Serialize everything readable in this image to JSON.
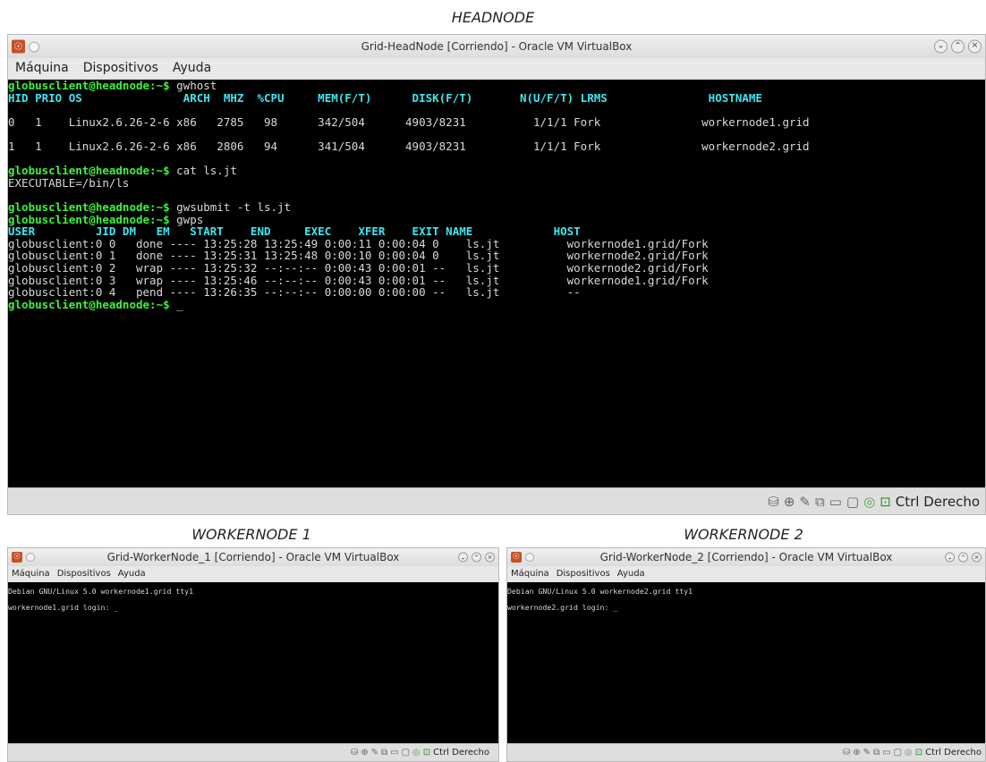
{
  "captions": {
    "headnode": "HEADNODE",
    "worker1": "WORKERNODE 1",
    "worker2": "WORKERNODE 2"
  },
  "headnode": {
    "title": "Grid-HeadNode [Corriendo] - Oracle VM VirtualBox",
    "menu": [
      "Máquina",
      "Dispositivos",
      "Ayuda"
    ],
    "host_key": "Ctrl Derecho",
    "terminal": {
      "prompt": "globusclient@headnode:~$",
      "cmd1": " gwhost",
      "gwhost_header": "HID PRIO OS               ARCH  MHZ  %CPU     MEM(F/T)      DISK(F/T)       N(U/F/T) LRMS               HOSTNAME",
      "gwhost_rows": [
        "0   1    Linux2.6.26-2-6 x86   2785   98      342/504      4903/8231          1/1/1 Fork               workernode1.grid",
        "1   1    Linux2.6.26-2-6 x86   2806   94      341/504      4903/8231          1/1/1 Fork               workernode2.grid"
      ],
      "cmd2": " cat ls.jt",
      "cat_output": "EXECUTABLE=/bin/ls",
      "cmd3": " gwsubmit -t ls.jt",
      "cmd4": " gwps",
      "gwps_header": "USER         JID DM   EM   START    END     EXEC    XFER    EXIT NAME            HOST",
      "gwps_rows": [
        "globusclient:0 0   done ---- 13:25:28 13:25:49 0:00:11 0:00:04 0    ls.jt          workernode1.grid/Fork",
        "globusclient:0 1   done ---- 13:25:31 13:25:48 0:00:10 0:00:04 0    ls.jt          workernode2.grid/Fork",
        "globusclient:0 2   wrap ---- 13:25:32 --:--:-- 0:00:43 0:00:01 --   ls.jt          workernode2.grid/Fork",
        "globusclient:0 3   wrap ---- 13:25:46 --:--:-- 0:00:43 0:00:01 --   ls.jt          workernode1.grid/Fork",
        "globusclient:0 4   pend ---- 13:26:35 --:--:-- 0:00:00 0:00:00 --   ls.jt          --"
      ],
      "cursor": "_"
    }
  },
  "worker1": {
    "title": "Grid-WorkerNode_1 [Corriendo] - Oracle VM VirtualBox",
    "menu": [
      "Máquina",
      "Dispositivos",
      "Ayuda"
    ],
    "host_key": "Ctrl Derecho",
    "terminal": {
      "banner": "Debian GNU/Linux 5.0 workernode1.grid tty1",
      "login": "workernode1.grid login: ",
      "cursor": "_"
    }
  },
  "worker2": {
    "title": "Grid-WorkerNode_2 [Corriendo] - Oracle VM VirtualBox",
    "menu": [
      "Máquina",
      "Dispositivos",
      "Ayuda"
    ],
    "host_key": "Ctrl Derecho",
    "terminal": {
      "banner": "Debian GNU/Linux 5.0 workernode2.grid tty1",
      "login": "workernode2.grid login: ",
      "cursor": "_"
    }
  },
  "colors": {
    "prompt": "#3df23d",
    "header": "#3ee6f2",
    "text": "#d8d8d8",
    "vbox_icon": "#c94f26"
  }
}
